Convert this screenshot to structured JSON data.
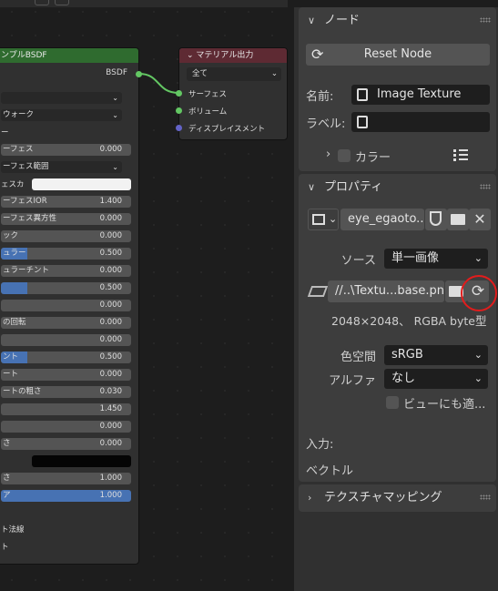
{
  "bsdf_node": {
    "title": "ンプルBSDF",
    "output_label": "BSDF",
    "rows": [
      {
        "label": "",
        "value": "",
        "kind": "dropdown"
      },
      {
        "label": "ウォーク",
        "value": "",
        "kind": "dropdown"
      },
      {
        "label": "ー",
        "value": "",
        "kind": "text"
      },
      {
        "label": "ーフェス",
        "value": "0.000",
        "kind": "slider",
        "fill": 0
      },
      {
        "label": "ーフェス範囲",
        "value": "",
        "kind": "dropdown"
      },
      {
        "label": "ェスカ",
        "value": "",
        "kind": "color",
        "color": "#f2f2f2"
      },
      {
        "label": "ーフェスIOR",
        "value": "1.400",
        "kind": "slider",
        "fill": 0
      },
      {
        "label": "ーフェス異方性",
        "value": "0.000",
        "kind": "slider",
        "fill": 0
      },
      {
        "label": "ック",
        "value": "0.000",
        "kind": "slider",
        "fill": 0
      },
      {
        "label": "ュラー",
        "value": "0.500",
        "kind": "slider",
        "fill": 0.5
      },
      {
        "label": "ュラーチント",
        "value": "0.000",
        "kind": "slider",
        "fill": 0
      },
      {
        "label": "",
        "value": "0.500",
        "kind": "slider",
        "fill": 0.5
      },
      {
        "label": "",
        "value": "0.000",
        "kind": "slider",
        "fill": 0
      },
      {
        "label": "の回転",
        "value": "0.000",
        "kind": "slider",
        "fill": 0
      },
      {
        "label": "",
        "value": "0.000",
        "kind": "slider",
        "fill": 0
      },
      {
        "label": "ント",
        "value": "0.500",
        "kind": "slider",
        "fill": 0.5
      },
      {
        "label": "ート",
        "value": "0.000",
        "kind": "slider",
        "fill": 0
      },
      {
        "label": "ートの粗さ",
        "value": "0.030",
        "kind": "slider",
        "fill": 0
      },
      {
        "label": "",
        "value": "1.450",
        "kind": "slider",
        "fill": 0
      },
      {
        "label": "",
        "value": "0.000",
        "kind": "slider",
        "fill": 0
      },
      {
        "label": "さ",
        "value": "0.000",
        "kind": "slider",
        "fill": 0
      },
      {
        "label": "",
        "value": "",
        "kind": "color",
        "color": "#050505"
      },
      {
        "label": "さ",
        "value": "1.000",
        "kind": "slider",
        "fill": 0
      },
      {
        "label": "ア",
        "value": "1.000",
        "kind": "slider",
        "fill": 1
      },
      {
        "label": "ト法線",
        "value": "",
        "kind": "text"
      },
      {
        "label": "ト",
        "value": "",
        "kind": "text"
      }
    ]
  },
  "material_output_node": {
    "title": "マテリアル出力",
    "target": "全て",
    "sockets": [
      {
        "label": "サーフェス",
        "color": "#63c763"
      },
      {
        "label": "ボリューム",
        "color": "#63c763"
      },
      {
        "label": "ディスプレイスメント",
        "color": "#6363c7"
      }
    ]
  },
  "sidebar": {
    "node_panel": {
      "title": "ノード",
      "reset_label": "Reset Node",
      "name_label": "名前:",
      "name_value": "Image Texture",
      "label_label": "ラベル:",
      "label_value": "",
      "color_label": "カラー"
    },
    "properties_panel": {
      "title": "プロパティ",
      "image_name": "eye_egaoto...",
      "source_label": "ソース",
      "source_value": "単一画像",
      "filepath": "//..\\Textu...base.png",
      "image_info": "2048×2048、 RGBA byte型",
      "colorspace_label": "色空間",
      "colorspace_value": "sRGB",
      "alpha_label": "アルファ",
      "alpha_value": "なし",
      "view_as_render_label": "ビューにも適...",
      "input_label": "入力:",
      "vector_label": "ベクトル"
    },
    "texture_mapping_panel": {
      "title": "テクスチャマッピング"
    }
  },
  "colors": {
    "highlight_circle": "#e21c1c",
    "bsdf_header": "#2f6b2f",
    "material_header": "#5e2a33",
    "slider_fill": "#4772b3"
  }
}
